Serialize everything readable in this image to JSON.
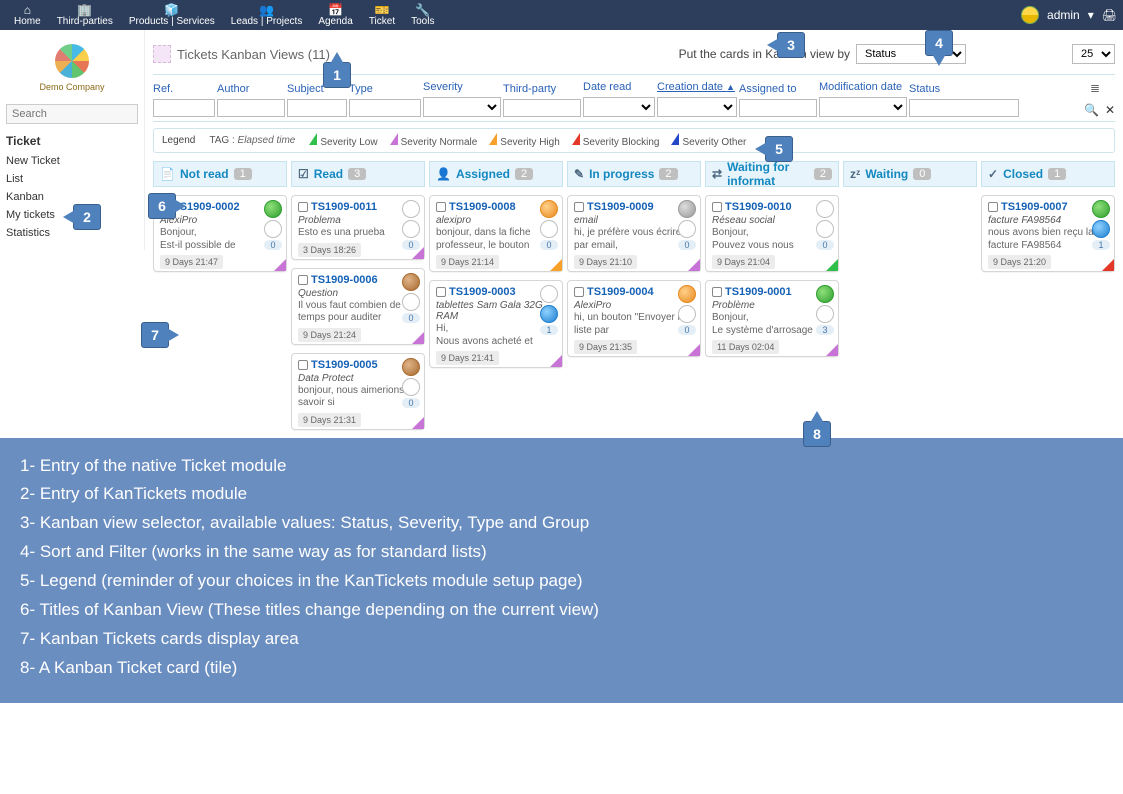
{
  "top_menu": {
    "items": [
      "Home",
      "Third-parties",
      "Products | Services",
      "Leads | Projects",
      "Agenda",
      "Ticket",
      "Tools"
    ],
    "icons": [
      "⌂",
      "🏢",
      "🧊",
      "👥",
      "📅",
      "🎫",
      "🔧"
    ]
  },
  "top_right": {
    "user": "admin",
    "dropdown": "▾",
    "print": "🖨"
  },
  "logo": {
    "caption": "Demo Company"
  },
  "sidebar": {
    "search_placeholder": "Search",
    "heading": "Ticket",
    "items": [
      "New Ticket",
      "List",
      "Kanban",
      "My tickets",
      "Statistics"
    ]
  },
  "header": {
    "title": "Tickets Kanban Views (11)",
    "viewby_label": "Put the cards in Kanban view by",
    "viewby_value": "Status",
    "page_size": "25"
  },
  "filters": {
    "cols": [
      "Ref.",
      "Author",
      "Subject",
      "Type",
      "Severity",
      "Third-party",
      "Date read",
      "Creation date",
      "Assigned to",
      "Modification date",
      "Status"
    ],
    "sorted": "Creation date",
    "sort_dir": "▲"
  },
  "legend": {
    "title": "Legend",
    "tag_label": "TAG :",
    "tag_value": "Elapsed time",
    "items": [
      "Severity Low",
      "Severity Normale",
      "Severity High",
      "Severity Blocking",
      "Severity Other"
    ]
  },
  "columns": [
    {
      "title": "Not read",
      "count": "1",
      "icon": "📄"
    },
    {
      "title": "Read",
      "count": "3",
      "icon": "☑"
    },
    {
      "title": "Assigned",
      "count": "2",
      "icon": "👤"
    },
    {
      "title": "In progress",
      "count": "2",
      "icon": "✎"
    },
    {
      "title": "Waiting for informat",
      "count": "2",
      "icon": "⇄"
    },
    {
      "title": "Waiting",
      "count": "0",
      "icon": "zᶻ"
    },
    {
      "title": "Closed",
      "count": "1",
      "icon": "✓"
    }
  ],
  "cards": {
    "0": [
      {
        "ref": "TS1909-0002",
        "subj": "AlexiPro",
        "msg": "Bonjour,\nEst-il possible de",
        "date": "9 Days 21:47",
        "c1": "green",
        "c2": "white",
        "n": "0",
        "corner": "#c874d6"
      }
    ],
    "1": [
      {
        "ref": "TS1909-0011",
        "subj": "Problema",
        "msg": "Esto es una prueba",
        "date": "3 Days 18:26",
        "c1": "white",
        "c2": "white",
        "n": "0",
        "corner": "#c874d6"
      },
      {
        "ref": "TS1909-0006",
        "subj": "Question",
        "msg": "Il vous faut combien de temps pour auditer",
        "date": "9 Days 21:24",
        "c1": "brown",
        "c2": "white",
        "n": "0",
        "corner": "#c874d6"
      },
      {
        "ref": "TS1909-0005",
        "subj": "Data Protect",
        "msg": "bonjour, nous aimerions savoir si",
        "date": "9 Days 21:31",
        "c1": "brown",
        "c2": "white",
        "n": "0",
        "corner": "#c874d6"
      }
    ],
    "2": [
      {
        "ref": "TS1909-0008",
        "subj": "alexipro",
        "msg": "bonjour, dans la fiche professeur, le bouton",
        "date": "9 Days 21:14",
        "c1": "orange",
        "c2": "white",
        "n": "0",
        "corner": "#f7a12b"
      },
      {
        "ref": "TS1909-0003",
        "subj": "tablettes Sam Gala 32G RAM",
        "msg": "Hi,\nNous avons acheté et",
        "date": "9 Days 21:41",
        "c1": "white",
        "c2": "blue",
        "n": "1",
        "corner": "#c874d6"
      }
    ],
    "3": [
      {
        "ref": "TS1909-0009",
        "subj": "email",
        "msg": "hi, je préfère vous écrire par email,",
        "date": "9 Days 21:10",
        "c1": "gray",
        "c2": "white",
        "n": "0",
        "corner": "#c874d6"
      },
      {
        "ref": "TS1909-0004",
        "subj": "AlexiPro",
        "msg": "hi, un bouton \"Envoyer la liste par",
        "date": "9 Days 21:35",
        "c1": "orange",
        "c2": "white",
        "n": "0",
        "corner": "#c874d6"
      }
    ],
    "4": [
      {
        "ref": "TS1909-0010",
        "subj": "Réseau social",
        "msg": "Bonjour,\nPouvez vous nous",
        "date": "9 Days 21:04",
        "c1": "white",
        "c2": "white",
        "n": "0",
        "corner": "#2fbf4a"
      },
      {
        "ref": "TS1909-0001",
        "subj": "Problème",
        "msg": "Bonjour,\nLe système d'arrosage",
        "date": "11 Days 02:04",
        "c1": "green",
        "c2": "white",
        "n": "3",
        "corner": "#c874d6"
      }
    ],
    "5": [],
    "6": [
      {
        "ref": "TS1909-0007",
        "subj": "facture FA98564",
        "msg": "nous avons bien reçu la facture FA98564",
        "date": "9 Days 21:20",
        "c1": "green",
        "c2": "blue",
        "n": "1",
        "corner": "#e33828"
      }
    ]
  },
  "callouts": {
    "1": "1",
    "2": "2",
    "3": "3",
    "4": "4",
    "5": "5",
    "6": "6",
    "7": "7",
    "8": "8"
  },
  "legend_text": [
    "1- Entry of the native Ticket module",
    "2- Entry of KanTickets module",
    "3- Kanban view selector, available values: Status, Severity, Type and Group",
    "4- Sort and Filter (works in the same way as for standard lists)",
    "5- Legend (reminder of your choices in the KanTickets module setup page)",
    "6- Titles of Kanban View (These titles change depending on the current view)",
    "7- Kanban Tickets cards display area",
    "8- A Kanban Ticket card (tile)"
  ]
}
